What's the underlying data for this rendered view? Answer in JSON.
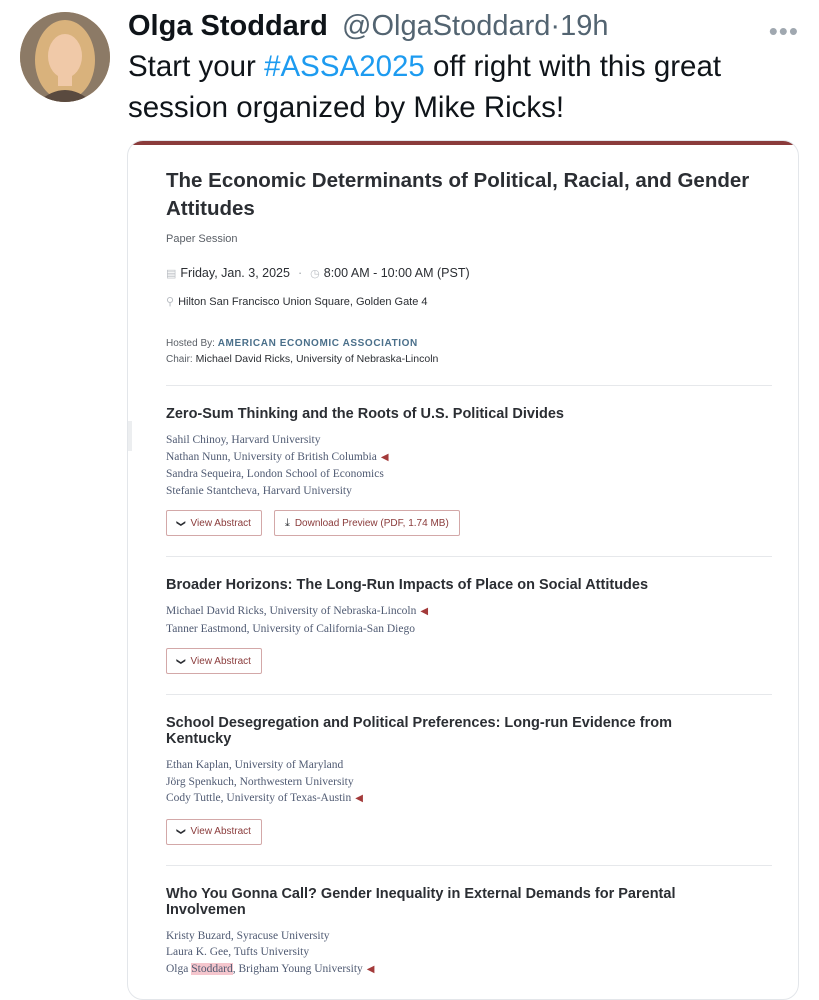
{
  "tweet": {
    "author_name": "Olga Stoddard",
    "handle": "@OlgaStoddard",
    "time_sep": "·",
    "time": "19h",
    "more": "•••",
    "text_before": "Start your ",
    "hashtag": "#ASSA2025",
    "text_after": " off right with this great session organized by Mike Ricks!"
  },
  "session": {
    "title": "The Economic Determinants of Political, Racial, and Gender Attitudes",
    "type": "Paper Session",
    "date": "Friday, Jan. 3, 2025",
    "time": "8:00 AM - 10:00 AM (PST)",
    "location": "Hilton San Francisco Union Square, Golden Gate 4",
    "hosted_label": "Hosted By:",
    "hosted_org": "AMERICAN ECONOMIC ASSOCIATION",
    "chair_label": "Chair:",
    "chair": "Michael David Ricks, University of Nebraska-Lincoln"
  },
  "buttons": {
    "view_abstract": "View Abstract",
    "download_preview": "Download Preview (PDF, 1.74 MB)"
  },
  "papers": [
    {
      "title": "Zero-Sum Thinking and the Roots of U.S. Political Divides",
      "authors": [
        "Sahil Chinoy, Harvard University",
        "Nathan Nunn, University of British Columbia",
        "Sandra Sequeira, London School of Economics",
        "Stefanie Stantcheva, Harvard University"
      ]
    },
    {
      "title": "Broader Horizons: The Long-Run Impacts of Place on Social Attitudes",
      "authors": [
        "Michael David Ricks, University of Nebraska-Lincoln",
        "Tanner Eastmond, University of California-San Diego"
      ]
    },
    {
      "title": "School Desegregation and Political Preferences: Long-run Evidence from Kentucky",
      "authors": [
        "Ethan Kaplan, University of Maryland",
        "Jörg Spenkuch, Northwestern University",
        "Cody Tuttle, University of Texas-Austin"
      ]
    },
    {
      "title": "Who You Gonna Call? Gender Inequality in External Demands for Parental Involvemen",
      "authors": [
        "Kristy Buzard, Syracuse University",
        "Laura K. Gee, Tufts University",
        "Olga ",
        "Stoddard",
        ", Brigham Young University"
      ]
    }
  ],
  "colors": {
    "accent": "#8a3b3b",
    "hashtag": "#1d9bf0",
    "author_text": "#4f5a72",
    "highlight": "#f5c6cd"
  },
  "icons": [
    "calendar-icon",
    "clock-icon",
    "location-pin-icon",
    "chevron-down-icon",
    "download-icon",
    "megaphone-icon",
    "more-icon"
  ]
}
